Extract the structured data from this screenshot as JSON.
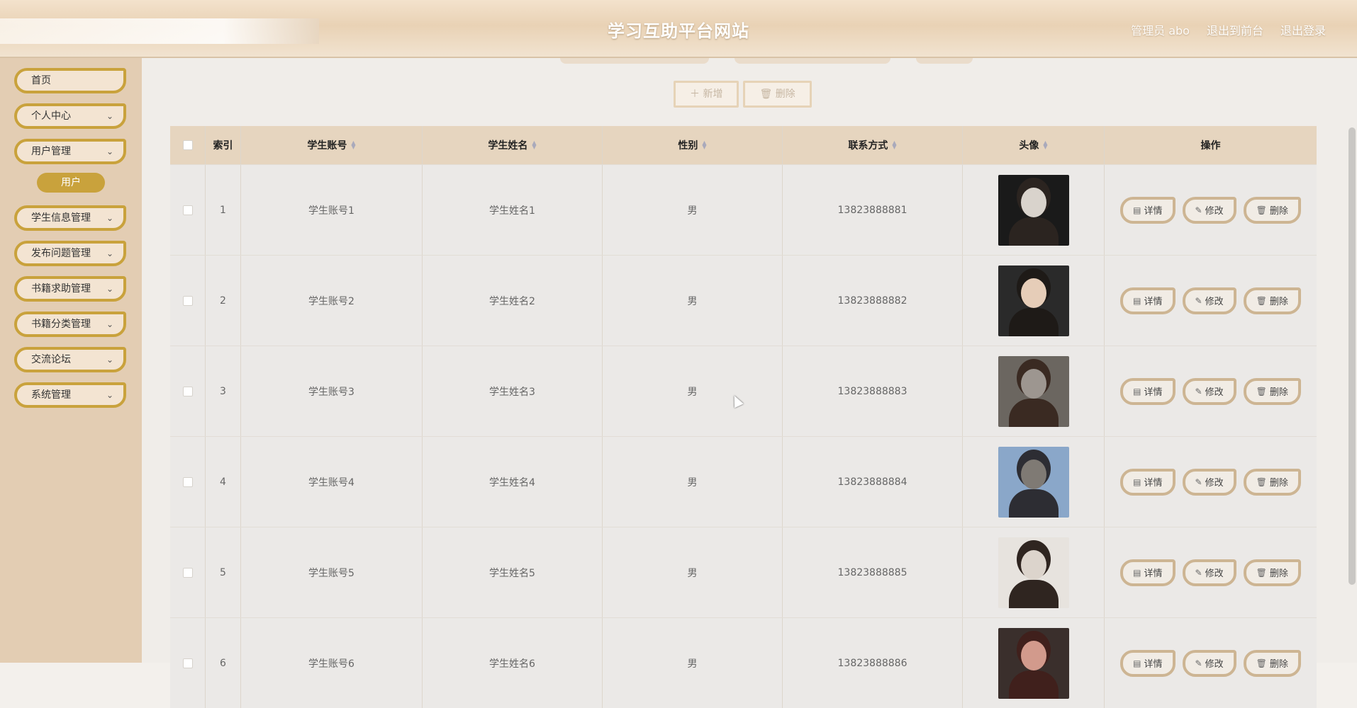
{
  "header": {
    "title": "学习互助平台网站",
    "admin_label": "管理员 abo",
    "to_front_label": "退出到前台",
    "logout_label": "退出登录"
  },
  "sidebar": {
    "items": [
      {
        "label": "首页",
        "has_chevron": false
      },
      {
        "label": "个人中心",
        "has_chevron": true
      },
      {
        "label": "用户管理",
        "has_chevron": true
      },
      {
        "label": "学生信息管理",
        "has_chevron": true
      },
      {
        "label": "发布问题管理",
        "has_chevron": true
      },
      {
        "label": "书籍求助管理",
        "has_chevron": true
      },
      {
        "label": "书籍分类管理",
        "has_chevron": true
      },
      {
        "label": "交流论坛",
        "has_chevron": true
      },
      {
        "label": "系统管理",
        "has_chevron": true
      }
    ],
    "submenu_active": "用户",
    "chevron_icon": "chevron-down-icon"
  },
  "toolbar": {
    "add_label": "新增",
    "delete_label": "删除"
  },
  "table": {
    "columns": [
      "索引",
      "学生账号",
      "学生姓名",
      "性别",
      "联系方式",
      "头像",
      "操作"
    ],
    "rows": [
      {
        "index": "1",
        "account": "学生账号1",
        "name": "学生姓名1",
        "gender": "男",
        "phone": "13823888881"
      },
      {
        "index": "2",
        "account": "学生账号2",
        "name": "学生姓名2",
        "gender": "男",
        "phone": "13823888882"
      },
      {
        "index": "3",
        "account": "学生账号3",
        "name": "学生姓名3",
        "gender": "男",
        "phone": "13823888883"
      },
      {
        "index": "4",
        "account": "学生账号4",
        "name": "学生姓名4",
        "gender": "男",
        "phone": "13823888884"
      },
      {
        "index": "5",
        "account": "学生账号5",
        "name": "学生姓名5",
        "gender": "男",
        "phone": "13823888885"
      },
      {
        "index": "6",
        "account": "学生账号6",
        "name": "学生姓名6",
        "gender": "男",
        "phone": "13823888886"
      }
    ],
    "actions": {
      "detail": "详情",
      "edit": "修改",
      "delete": "删除"
    }
  },
  "colors": {
    "accent": "#c9a23c",
    "header_bg": "#e9d2b5",
    "sidebar_bg": "#e3cdb3",
    "table_header_bg": "#e6d5bf"
  }
}
